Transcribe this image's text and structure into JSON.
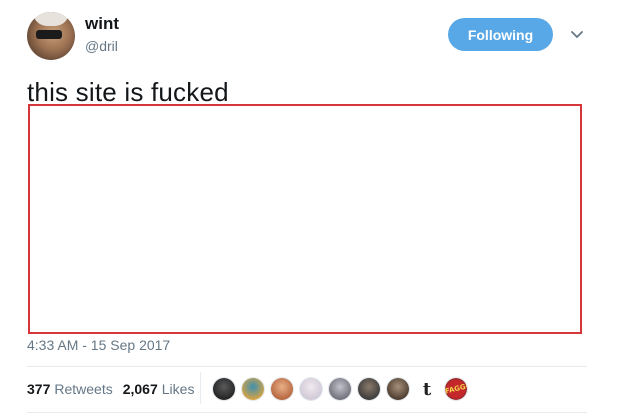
{
  "author": {
    "display_name": "wint",
    "handle": "@dril",
    "avatar_icon": "profile-photo-icon"
  },
  "follow_button": {
    "label": "Following",
    "color": "#58a7e6"
  },
  "menu": {
    "icon": "chevron-down-icon"
  },
  "tweet": {
    "text": "this site is fucked",
    "media_border_color": "#d6363a"
  },
  "timestamp": "4:33 AM - 15 Sep 2017",
  "stats": {
    "retweets_count": "377",
    "retweets_label": "Retweets",
    "likes_count": "2,067",
    "likes_label": "Likes"
  },
  "likers": [
    {
      "icon": "liker-avatar-icon",
      "colors": [
        "#222222",
        "#5a5a5a"
      ]
    },
    {
      "icon": "liker-avatar-icon",
      "colors": [
        "#d9a441",
        "#3f8fb0"
      ]
    },
    {
      "icon": "liker-avatar-icon",
      "colors": [
        "#b5643c",
        "#e8b089"
      ]
    },
    {
      "icon": "liker-avatar-icon",
      "colors": [
        "#cfc7d4",
        "#f1e9ef"
      ]
    },
    {
      "icon": "liker-avatar-icon",
      "colors": [
        "#6f6f7a",
        "#c2c2cc"
      ]
    },
    {
      "icon": "liker-avatar-icon",
      "colors": [
        "#3a3a3a",
        "#8a7a6a"
      ]
    },
    {
      "icon": "liker-avatar-icon",
      "colors": [
        "#4b3b2e",
        "#a78f79"
      ]
    },
    {
      "icon": "tumblr-t-icon",
      "text": "t"
    },
    {
      "icon": "liker-badge-icon",
      "text": "FAGGO",
      "colors": [
        "#c4282b",
        "#2b1b1b"
      ]
    }
  ]
}
